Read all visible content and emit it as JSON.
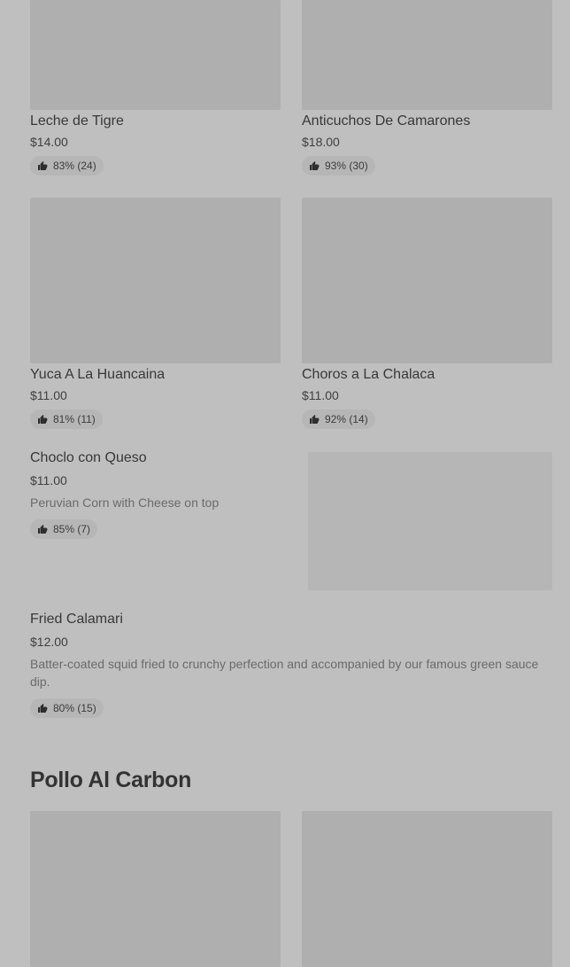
{
  "items": [
    {
      "name": "Leche de Tigre",
      "price": "$14.00",
      "rating": "83% (24)"
    },
    {
      "name": "Anticuchos De Camarones",
      "price": "$18.00",
      "rating": "93% (30)"
    },
    {
      "name": "Yuca A La Huancaina",
      "price": "$11.00",
      "rating": "81% (11)"
    },
    {
      "name": "Choros a La Chalaca",
      "price": "$11.00",
      "rating": "92% (14)"
    },
    {
      "name": "Choclo con Queso",
      "price": "$11.00",
      "description": "Peruvian Corn with Cheese on top",
      "rating": "85% (7)"
    },
    {
      "name": "Fried Calamari",
      "price": "$12.00",
      "description": "Batter-coated squid fried to crunchy perfection and accompanied by our famous green sauce dip.",
      "rating": "80% (15)"
    }
  ],
  "sections": [
    {
      "title": "Pollo Al Carbon"
    }
  ],
  "icons": {
    "rating": "thumbs-up-icon"
  },
  "colors": {
    "background": "#bfbfbf",
    "image_placeholder": "#afafaf",
    "rating_pill": "#b6b6b6"
  }
}
